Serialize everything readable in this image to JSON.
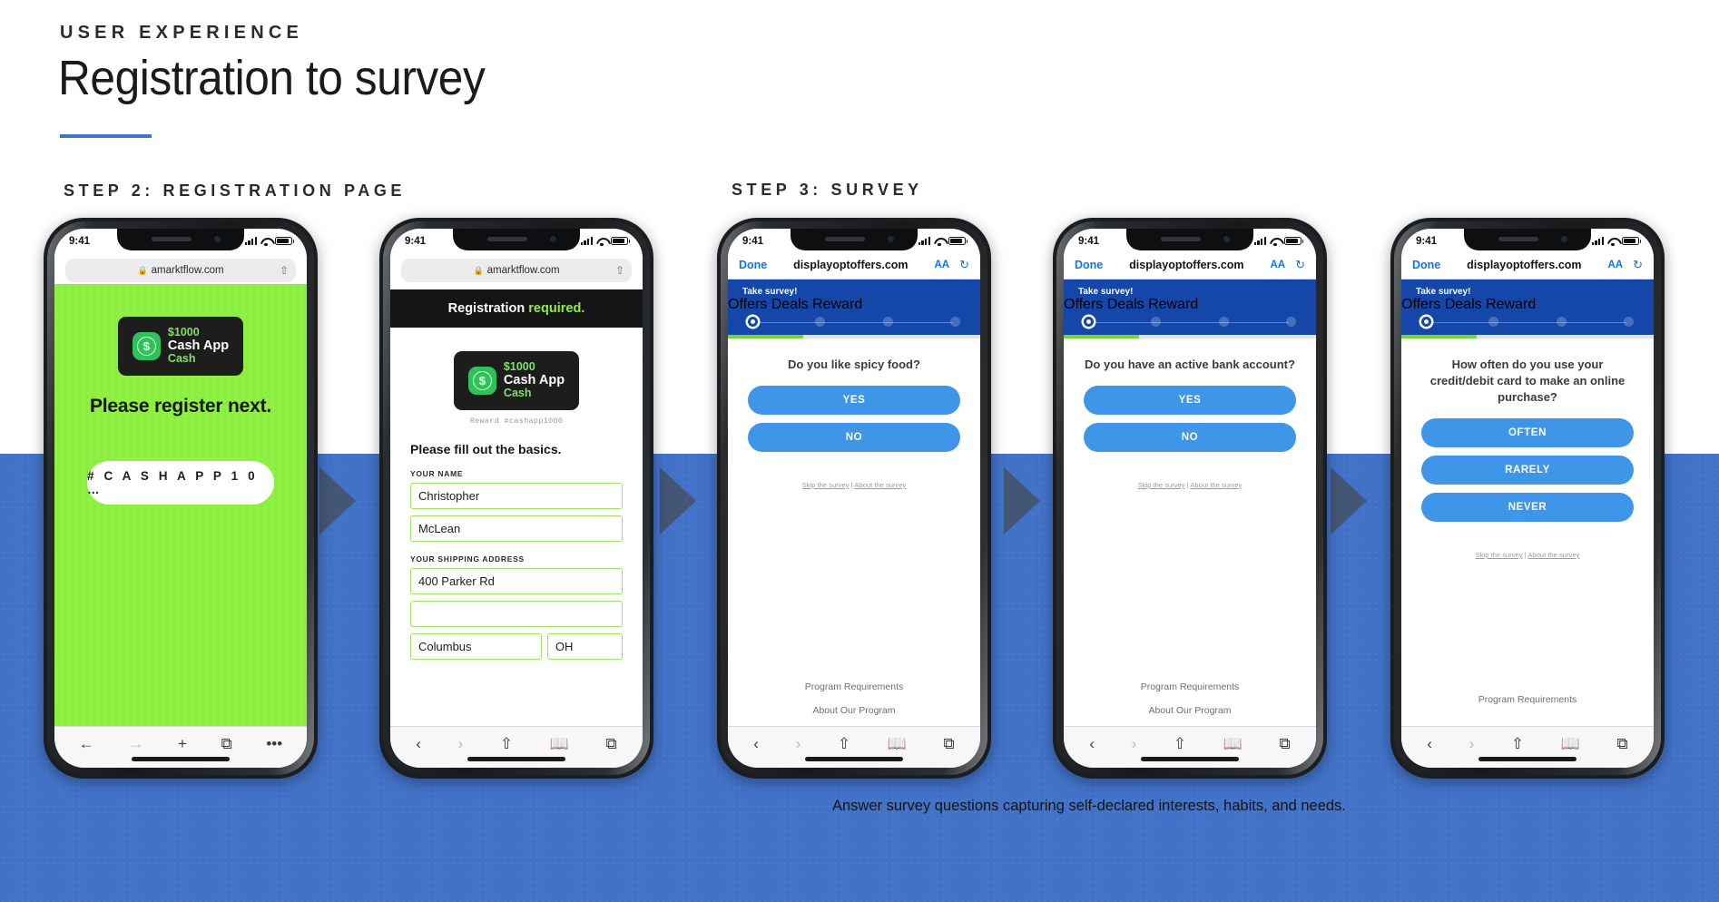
{
  "header": {
    "eyebrow": "USER EXPERIENCE",
    "title": "Registration to survey",
    "step2_label": "STEP 2: REGISTRATION PAGE",
    "step3_label": "STEP 3: SURVEY"
  },
  "caption": "Answer survey questions capturing self-declared interests, habits, and needs.",
  "colors": {
    "band_blue": "#4272c8",
    "accent_rule": "#3f74c9",
    "arrow": "#44546f",
    "green_page": "#8ef043",
    "survey_hero": "#1447a8",
    "answer_button": "#3f96e8",
    "progress_green": "#76d636",
    "field_border": "#a3e065"
  },
  "status_bar": {
    "time": "9:41",
    "signal_icon": "cellular-bars-icon",
    "wifi_icon": "wifi-icon",
    "battery_icon": "battery-icon"
  },
  "safari_bottom": {
    "back_icon": "chevron-left-icon",
    "forward_icon": "chevron-right-icon",
    "share_icon": "share-icon",
    "bookmarks_icon": "book-icon",
    "tabs_icon": "tabs-icon"
  },
  "phone1": {
    "url": "amarktflow.com",
    "lock_icon": "lock-icon",
    "share_icon": "share-icon",
    "card": {
      "amount": "$1000",
      "brand": "Cash App",
      "suffix": "Cash",
      "logo_symbol": "$"
    },
    "headline": "Please register next.",
    "hash_pill": "# C A S H A P P 1 0 …",
    "bottom_bar": {
      "back": "←",
      "forward": "→",
      "plus": "+",
      "tabs": "⧉",
      "more": "•••"
    }
  },
  "phone2": {
    "url": "amarktflow.com",
    "banner_prefix": "Registration ",
    "banner_highlight": "required.",
    "card": {
      "amount": "$1000",
      "brand": "Cash App",
      "suffix": "Cash",
      "logo_symbol": "$"
    },
    "reward_line": "Reward #cashapp1000",
    "form_heading": "Please fill out the basics.",
    "labels": {
      "name": "YOUR NAME",
      "address": "YOUR SHIPPING ADDRESS"
    },
    "fields": {
      "first_name": "Christopher",
      "last_name": "McLean",
      "address1": "400 Parker Rd",
      "address2": "",
      "city": "Columbus",
      "state": "OH"
    }
  },
  "survey_common": {
    "done_label": "Done",
    "host": "displayoptoffers.com",
    "aa_label": "AA",
    "refresh_icon": "refresh-icon",
    "hero_title": "Take survey!",
    "steps": [
      "Offers",
      "Deals",
      "Reward"
    ],
    "skip_text": "Skip the survey | About the survey",
    "skip_link_1": "Skip the survey",
    "skip_link_2": "About the survey",
    "footer_1": "Program Requirements",
    "footer_2": "About Our Program"
  },
  "phone3": {
    "question": "Do you like spicy food?",
    "answers": [
      "YES",
      "NO"
    ],
    "progress_pct": 30
  },
  "phone4": {
    "question": "Do you have an active bank account?",
    "answers": [
      "YES",
      "NO"
    ],
    "progress_pct": 30
  },
  "phone5": {
    "question": "How often do you use your credit/debit card to make an online purchase?",
    "answers": [
      "OFTEN",
      "RARELY",
      "NEVER"
    ],
    "progress_pct": 30
  }
}
